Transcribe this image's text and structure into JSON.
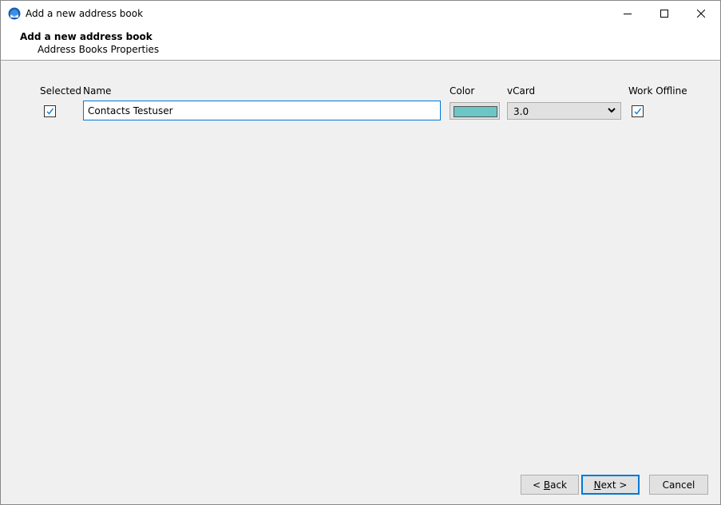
{
  "window": {
    "title": "Add a new address book",
    "app_icon": "thunderbird-icon",
    "controls": [
      "minimize",
      "maximize",
      "close"
    ]
  },
  "header": {
    "title": "Add a new address book",
    "subtitle": "Address Books Properties"
  },
  "columns": {
    "selected": "Selected",
    "name": "Name",
    "color": "Color",
    "vcard": "vCard",
    "work_offline": "Work Offline"
  },
  "row": {
    "selected": true,
    "name": "Contacts Testuser",
    "color": "#6cc6c6",
    "vcard": "3.0",
    "work_offline": true
  },
  "buttons": {
    "back": {
      "prefix": "< ",
      "accel": "B",
      "rest": "ack"
    },
    "next": {
      "prefix": "",
      "accel": "N",
      "rest": "ext >"
    },
    "cancel": "Cancel"
  },
  "colors": {
    "accent": "#0078d7",
    "check": "#0078d7"
  }
}
